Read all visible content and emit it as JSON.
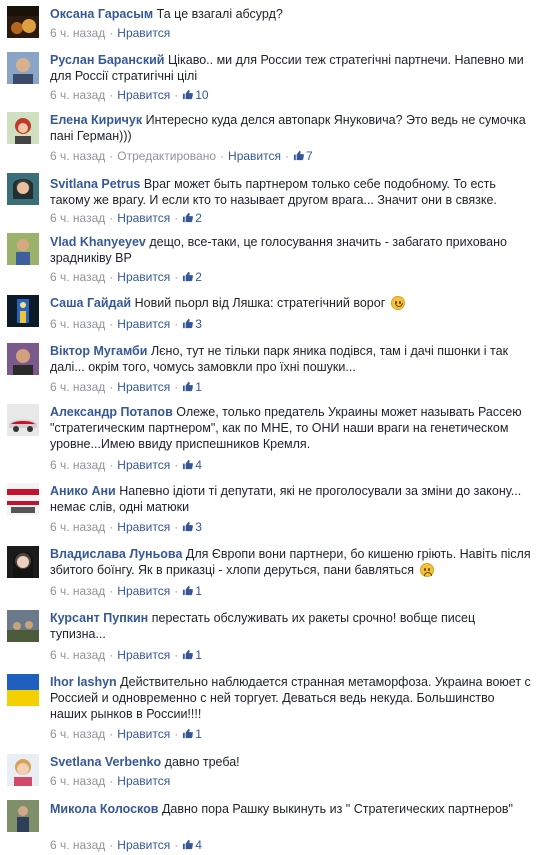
{
  "labels": {
    "like": "Нравится",
    "edited": "Отредактировано"
  },
  "comments": [
    {
      "author": "Оксана Гарасым",
      "text": "Та це взагалі абсурд?",
      "time": "6 ч. назад",
      "likes": ""
    },
    {
      "author": "Руслан Баранский",
      "text": "Цікаво.. ми для России теж стратегічні партнечи. Напевно ми для Россії стратигічні цілі",
      "time": "6 ч. назад",
      "likes": "10"
    },
    {
      "author": "Елена Киричук",
      "text": "Интересно куда делся автопарк Януковича? Это ведь не сумочка пані Герман)))",
      "time": "6 ч. назад",
      "likes": "7"
    },
    {
      "author": "Svitlana Petrus",
      "text": "Враг может быть партнером только себе подобному. То есть такому же врагу. И если кто то называет другом врага... Значит они в связке.",
      "time": "6 ч. назад",
      "likes": "2"
    },
    {
      "author": "Vlad Khanyeyev",
      "text": "дещо, все-таки, це голосування значить - забагато приховано зрадниківу ВР",
      "time": "6 ч. назад",
      "likes": "2"
    },
    {
      "author": "Саша Гайдай",
      "text": "Новий пьорл від Ляшка: стратегічний ворог",
      "time": "6 ч. назад",
      "likes": "3"
    },
    {
      "author": "Віктор Мугамби",
      "text": "Лєно, тут не тільки парк яника подівся, там і дачі пшонки і так далі... окрім того, чомусь замовкли про їхні пошуки...",
      "time": "6 ч. назад",
      "likes": "1"
    },
    {
      "author": "Александр Потапов",
      "text": "Олеже, только предатель Украины может называть Рассею \"стратегическим партнером\", как по МНЕ, то ОНИ наши враги на генетическом уровне...Имею ввиду приспешников Кремля.",
      "time": "6 ч. назад",
      "likes": "4"
    },
    {
      "author": "Анико Ани",
      "text": "Напевно ідіоти ті депутати, які не проголосували за зміни до закону... немає слів, одні матюки",
      "time": "6 ч. назад",
      "likes": "3"
    },
    {
      "author": "Владислава Луньова",
      "text": "Для Європи вони партнери, бо кишеню гріють. Навіть після збитого боїнгу. Як в приказці - хлопи деруться, пани бавляться",
      "time": "6 ч. назад",
      "likes": "1"
    },
    {
      "author": "Курсант Пупкин",
      "text": "перестать обслуживать их ракеты срочно! вобще писец тупизна...",
      "time": "6 ч. назад",
      "likes": "1"
    },
    {
      "author": "Ihor lashyn",
      "text": "Действительно наблюдается странная метаморфоза. Украина воюет с Россией и одновременно с ней торгует. Деваться ведь некуда. Большинство наших рынков в России!!!!",
      "time": "6 ч. назад",
      "likes": "1"
    },
    {
      "author": "Svetlana Verbenko",
      "text": "давно треба!",
      "time": "6 ч. назад",
      "likes": ""
    },
    {
      "author": "Микола Колосков",
      "text": "Давно пора Рашку выкинуть из \" Стратегических партнеров\"",
      "time": "6 ч. назад",
      "likes": "4"
    }
  ]
}
